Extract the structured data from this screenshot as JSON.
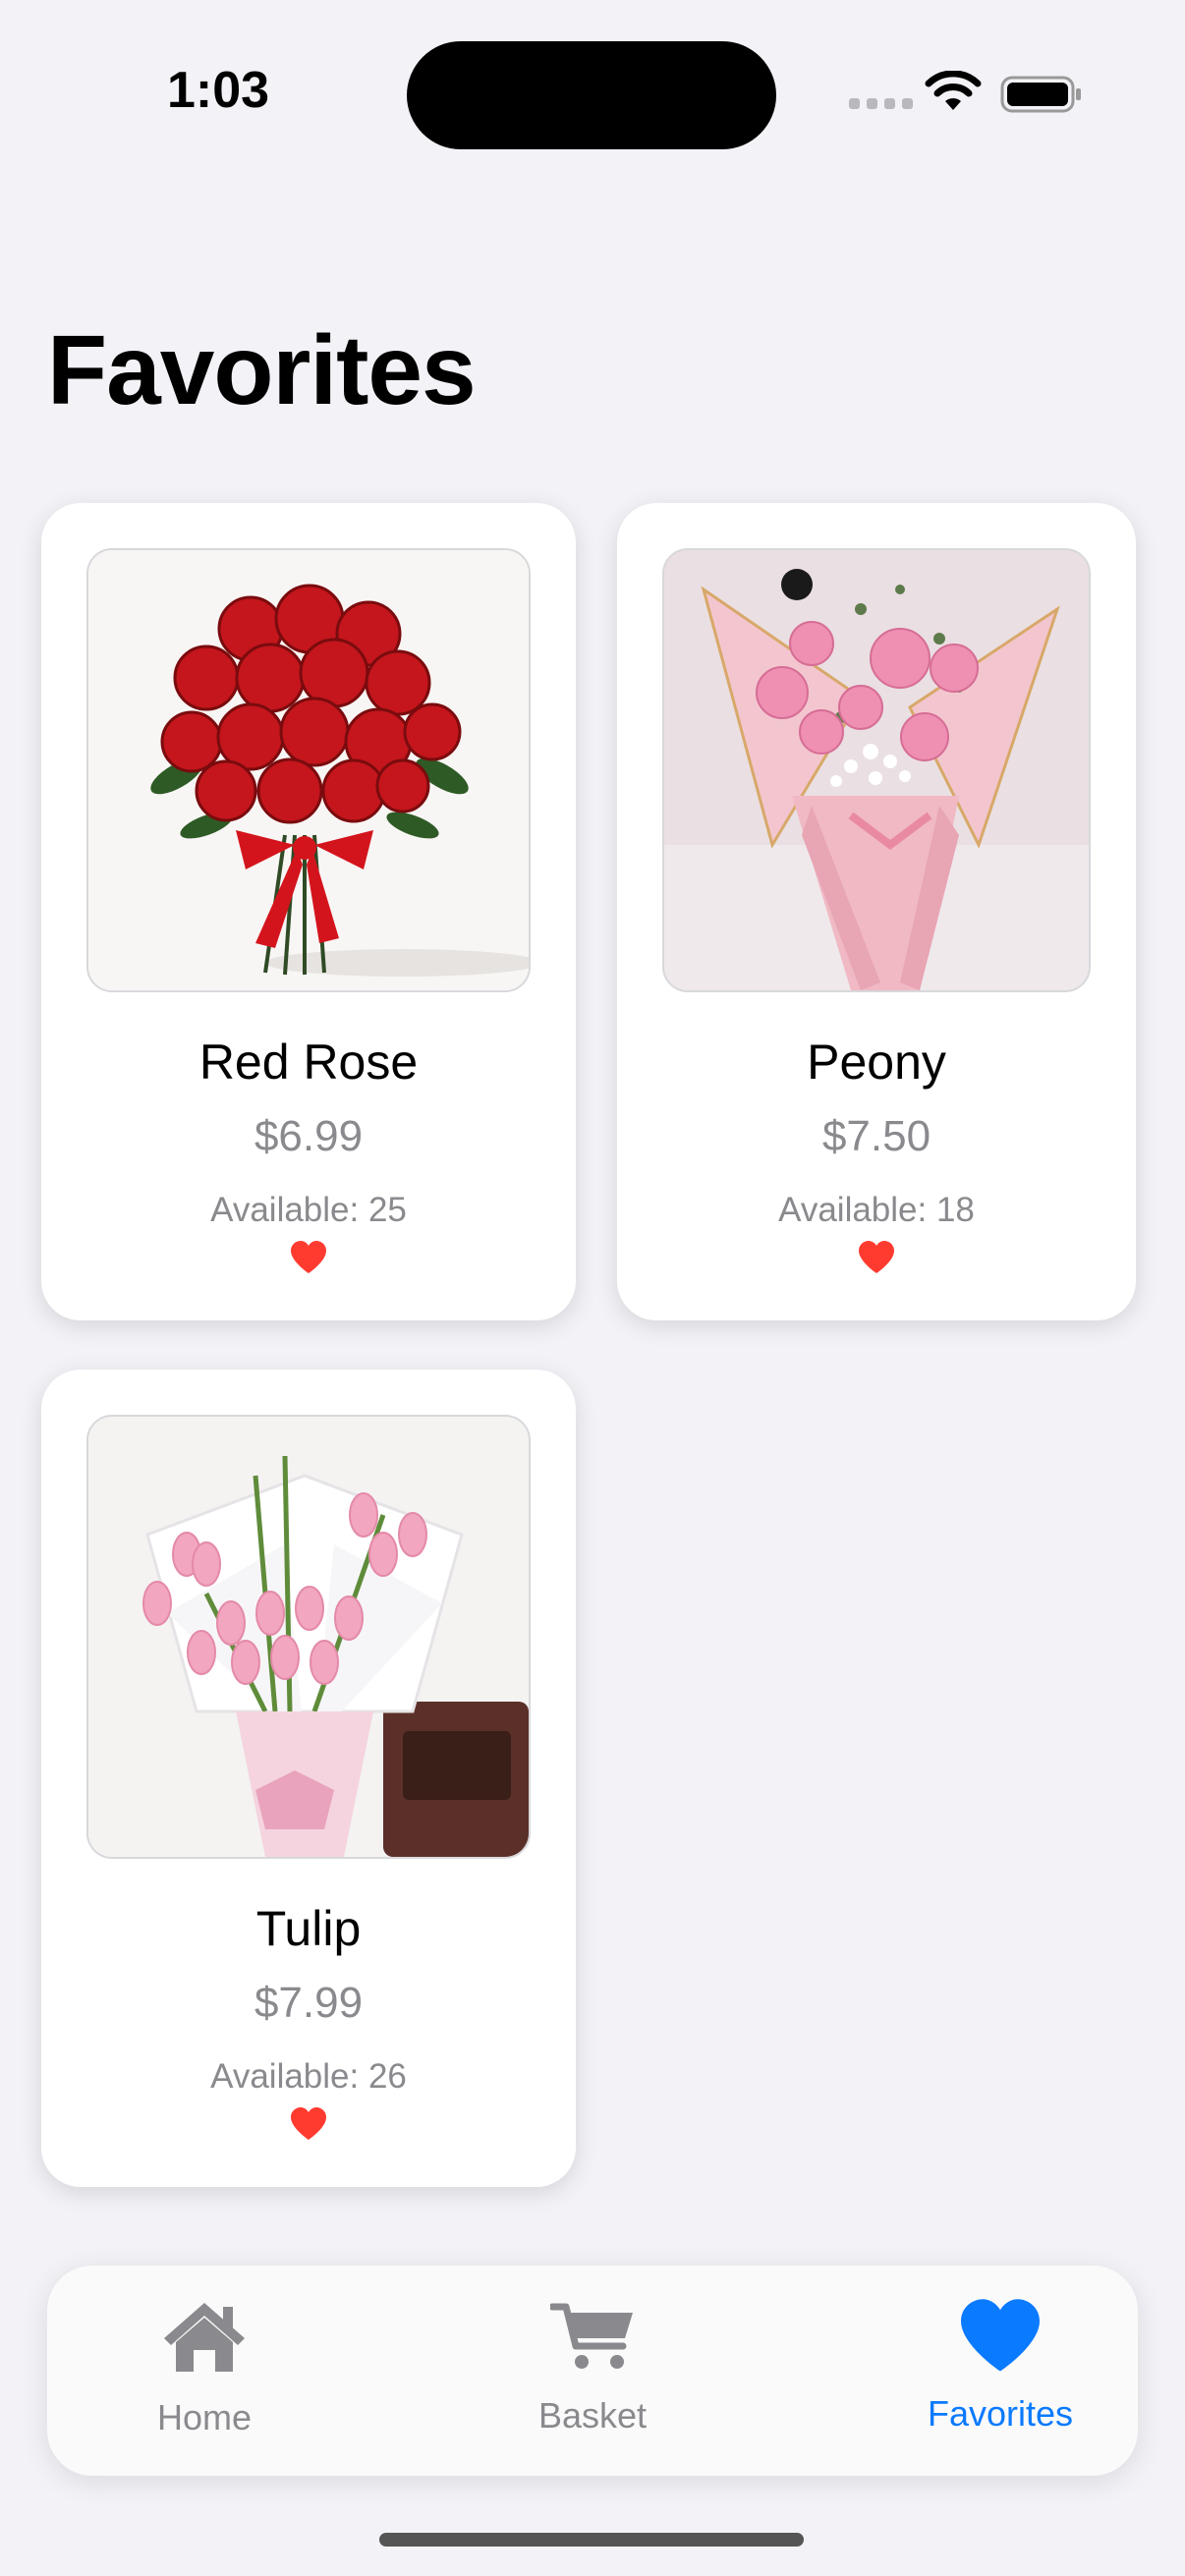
{
  "status_bar": {
    "time": "1:03"
  },
  "page": {
    "title": "Favorites"
  },
  "favorites": [
    {
      "name": "Red Rose",
      "price": "$6.99",
      "available": "Available: 25",
      "favorited": true
    },
    {
      "name": "Peony",
      "price": "$7.50",
      "available": "Available: 18",
      "favorited": true
    },
    {
      "name": "Tulip",
      "price": "$7.99",
      "available": "Available: 26",
      "favorited": true
    }
  ],
  "tabs": [
    {
      "label": "Home",
      "icon": "house-icon",
      "active": false
    },
    {
      "label": "Basket",
      "icon": "cart-icon",
      "active": false
    },
    {
      "label": "Favorites",
      "icon": "heart-icon",
      "active": true
    }
  ],
  "colors": {
    "accent": "#0a7aff",
    "heart": "#ff3b30",
    "background": "#f2f2f7"
  }
}
